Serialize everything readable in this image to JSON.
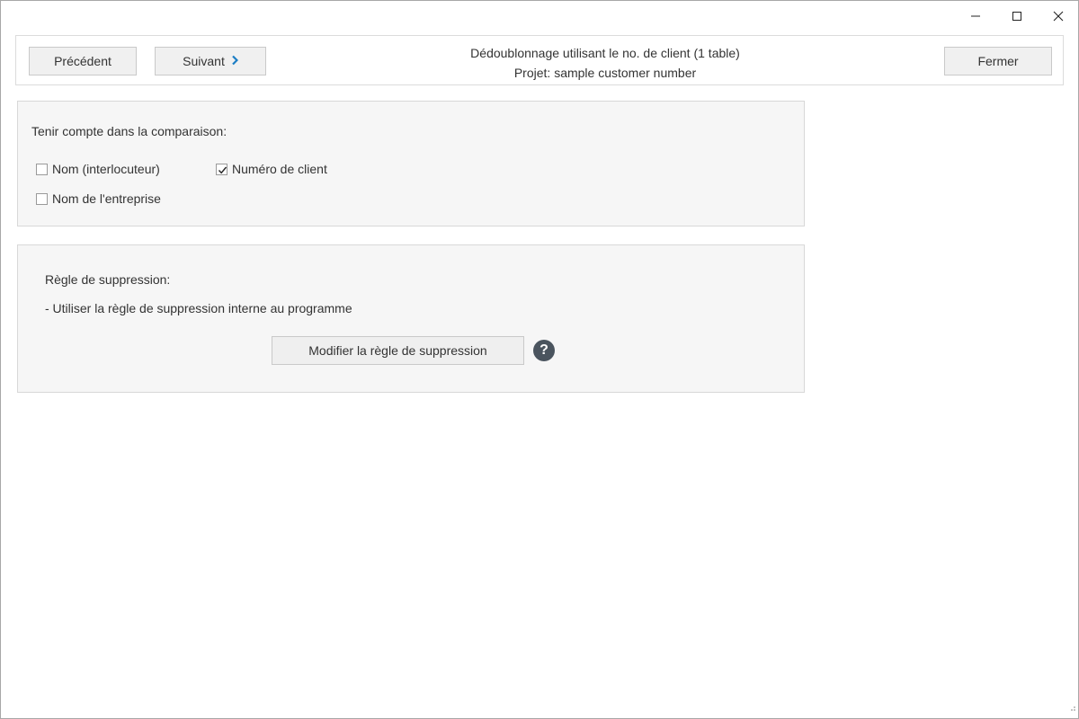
{
  "window": {
    "controls": {
      "minimize_icon": "minimize-icon",
      "maximize_icon": "maximize-icon",
      "close_icon": "close-icon"
    }
  },
  "toolbar": {
    "prev_label": "Précédent",
    "next_label": "Suivant",
    "next_icon": "chevron-right-icon",
    "close_label": "Fermer",
    "title": "Dédoublonnage utilisant le no. de client (1 table)",
    "project": "Projet: sample customer number"
  },
  "compare": {
    "heading": "Tenir compte dans la comparaison:",
    "options": [
      {
        "label": "Nom (interlocuteur)",
        "checked": false
      },
      {
        "label": "Numéro de client",
        "checked": true
      },
      {
        "label": "Nom de l'entreprise",
        "checked": false
      }
    ]
  },
  "rule": {
    "heading": "Règle de suppression:",
    "description": "- Utiliser la règle de suppression interne au programme",
    "modify_label": "Modifier la règle de suppression",
    "help_glyph": "?"
  },
  "colors": {
    "accent": "#1a7dc4",
    "help_bg": "#4a545e",
    "panel_bg": "#f6f6f6",
    "button_bg": "#f0f0f0"
  }
}
